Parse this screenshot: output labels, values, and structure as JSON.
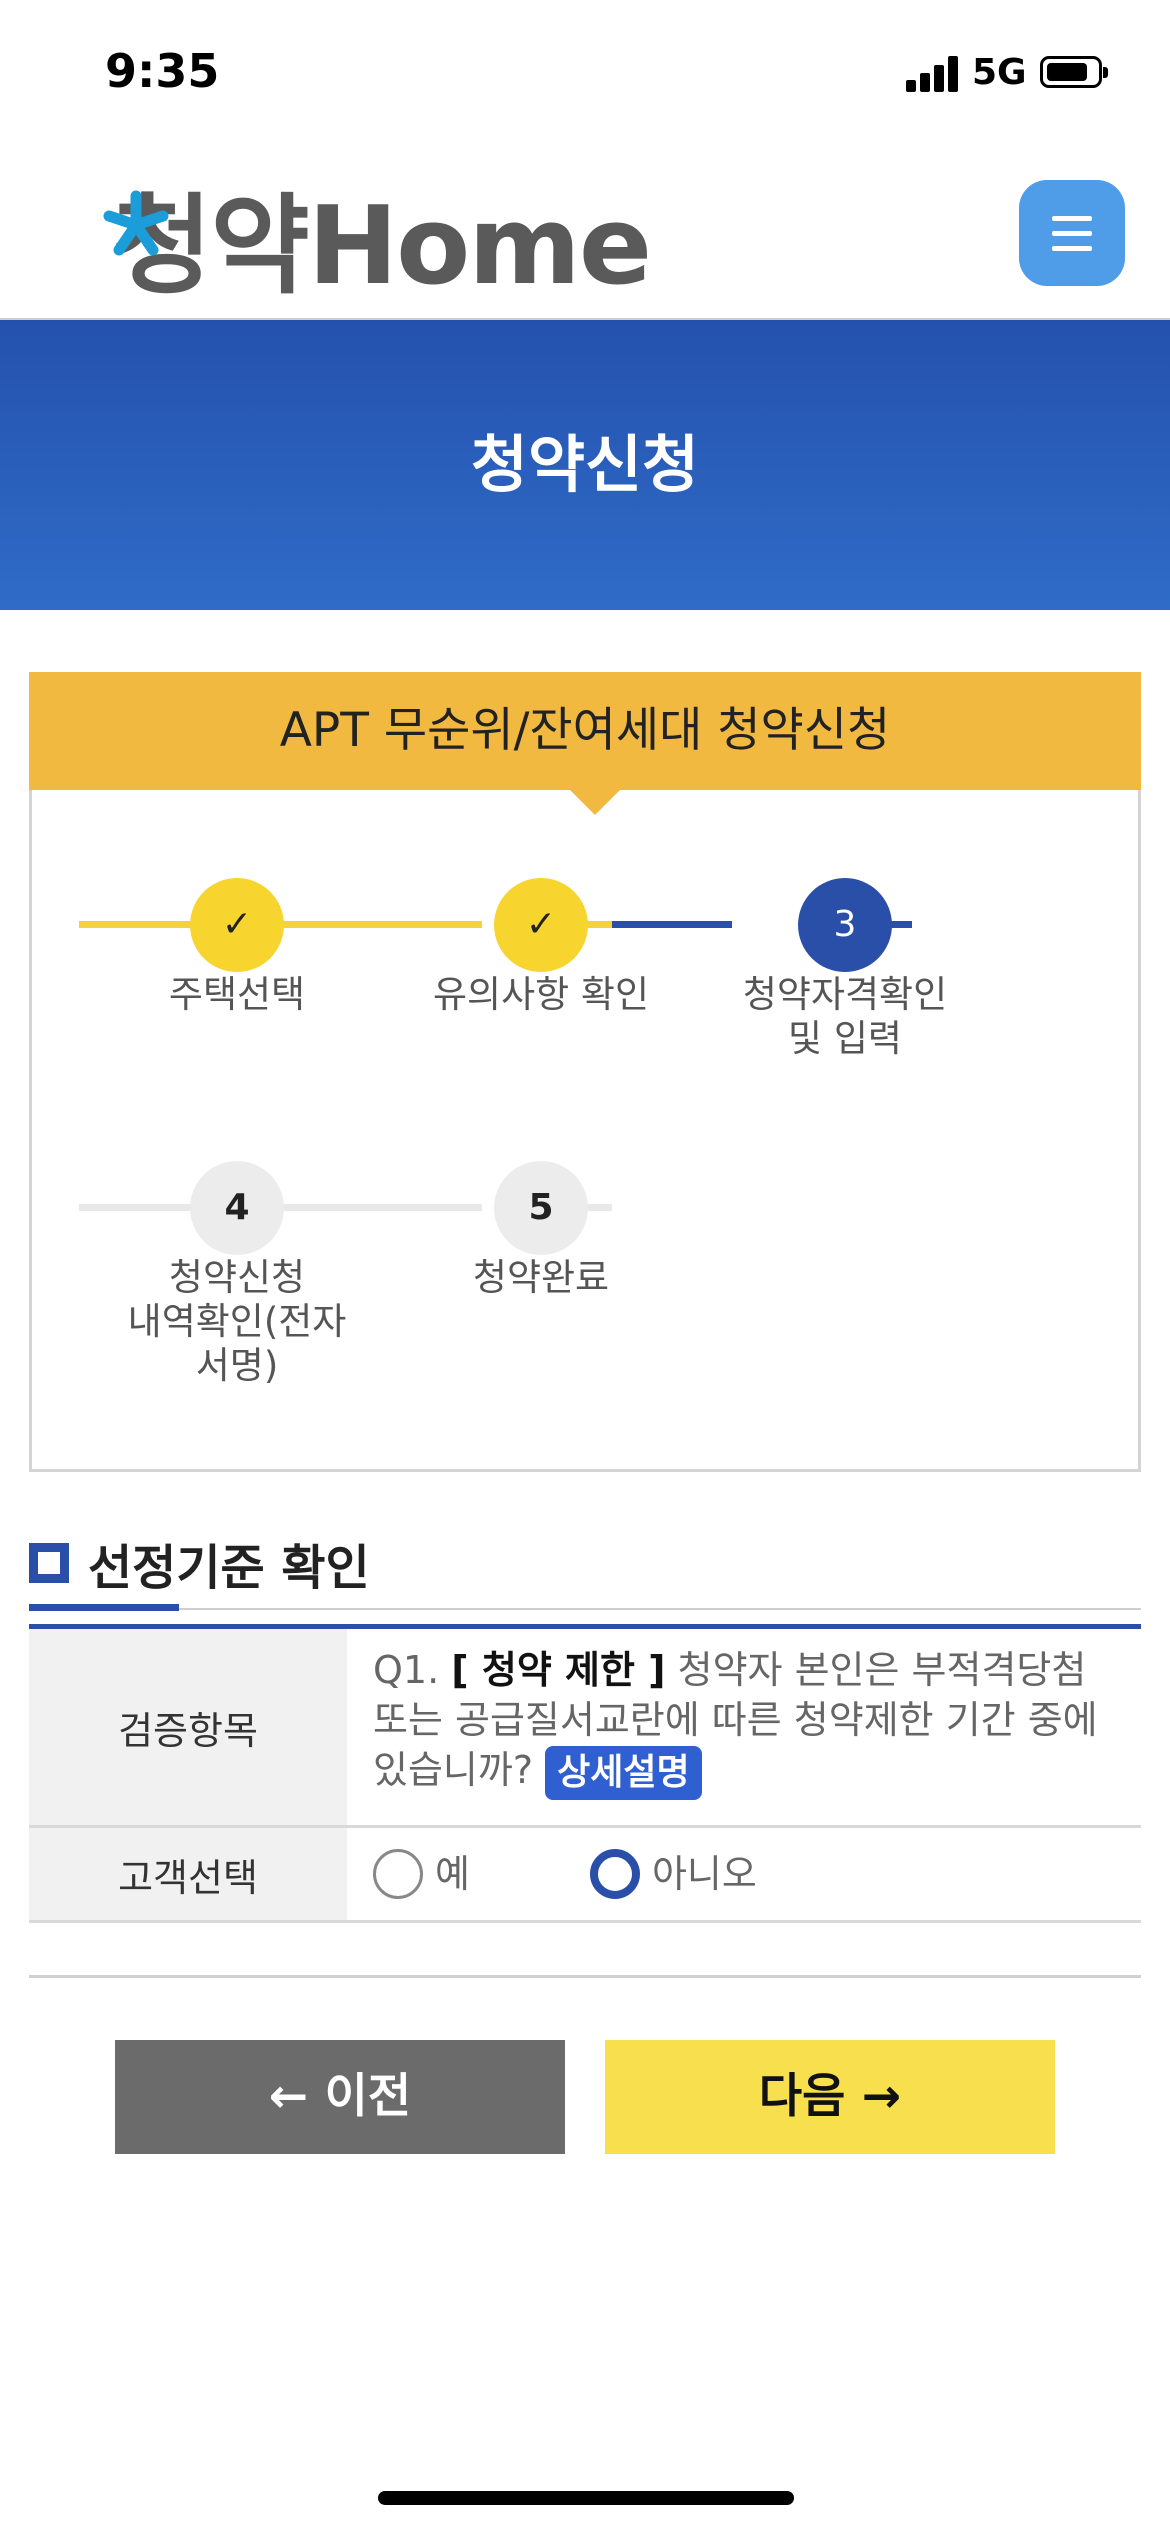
{
  "status_bar": {
    "time": "9:35",
    "network": "5G"
  },
  "header": {
    "logo_text": "청약Home",
    "menu_icon": "hamburger-menu-icon"
  },
  "banner": {
    "title": "청약신청"
  },
  "steps_card": {
    "title": "APT 무순위/잔여세대 청약신청",
    "steps": [
      {
        "marker": "✓",
        "label": "주택선택",
        "state": "done"
      },
      {
        "marker": "✓",
        "label": "유의사항 확인",
        "state": "done"
      },
      {
        "marker": "3",
        "label": "청약자격확인\n및 입력",
        "state": "current"
      },
      {
        "marker": "4",
        "label": "청약신청\n내역확인(전자\n서명)",
        "state": "todo"
      },
      {
        "marker": "5",
        "label": "청약완료",
        "state": "todo"
      }
    ]
  },
  "section": {
    "title": "선정기준 확인",
    "rows": {
      "check_item": {
        "header": "검증항목",
        "q_prefix": "Q1.",
        "q_strong": "[ 청약 제한 ]",
        "q_text": "청약자 본인은 부적격당첨 또는 공급질서교란에 따른 청약제한 기간 중에 있습니까?",
        "detail_button": "상세설명"
      },
      "customer_choice": {
        "header": "고객선택",
        "options": [
          {
            "label": "예",
            "selected": false
          },
          {
            "label": "아니오",
            "selected": true
          }
        ]
      }
    }
  },
  "buttons": {
    "prev": "← 이전",
    "next": "다음 →"
  },
  "colors": {
    "banner": "#2a5bb8",
    "card_header": "#f2b941",
    "step_done": "#f7d52e",
    "step_current": "#2a4fa8",
    "next_button": "#f7df4e",
    "prev_button": "#6b6b6b"
  }
}
